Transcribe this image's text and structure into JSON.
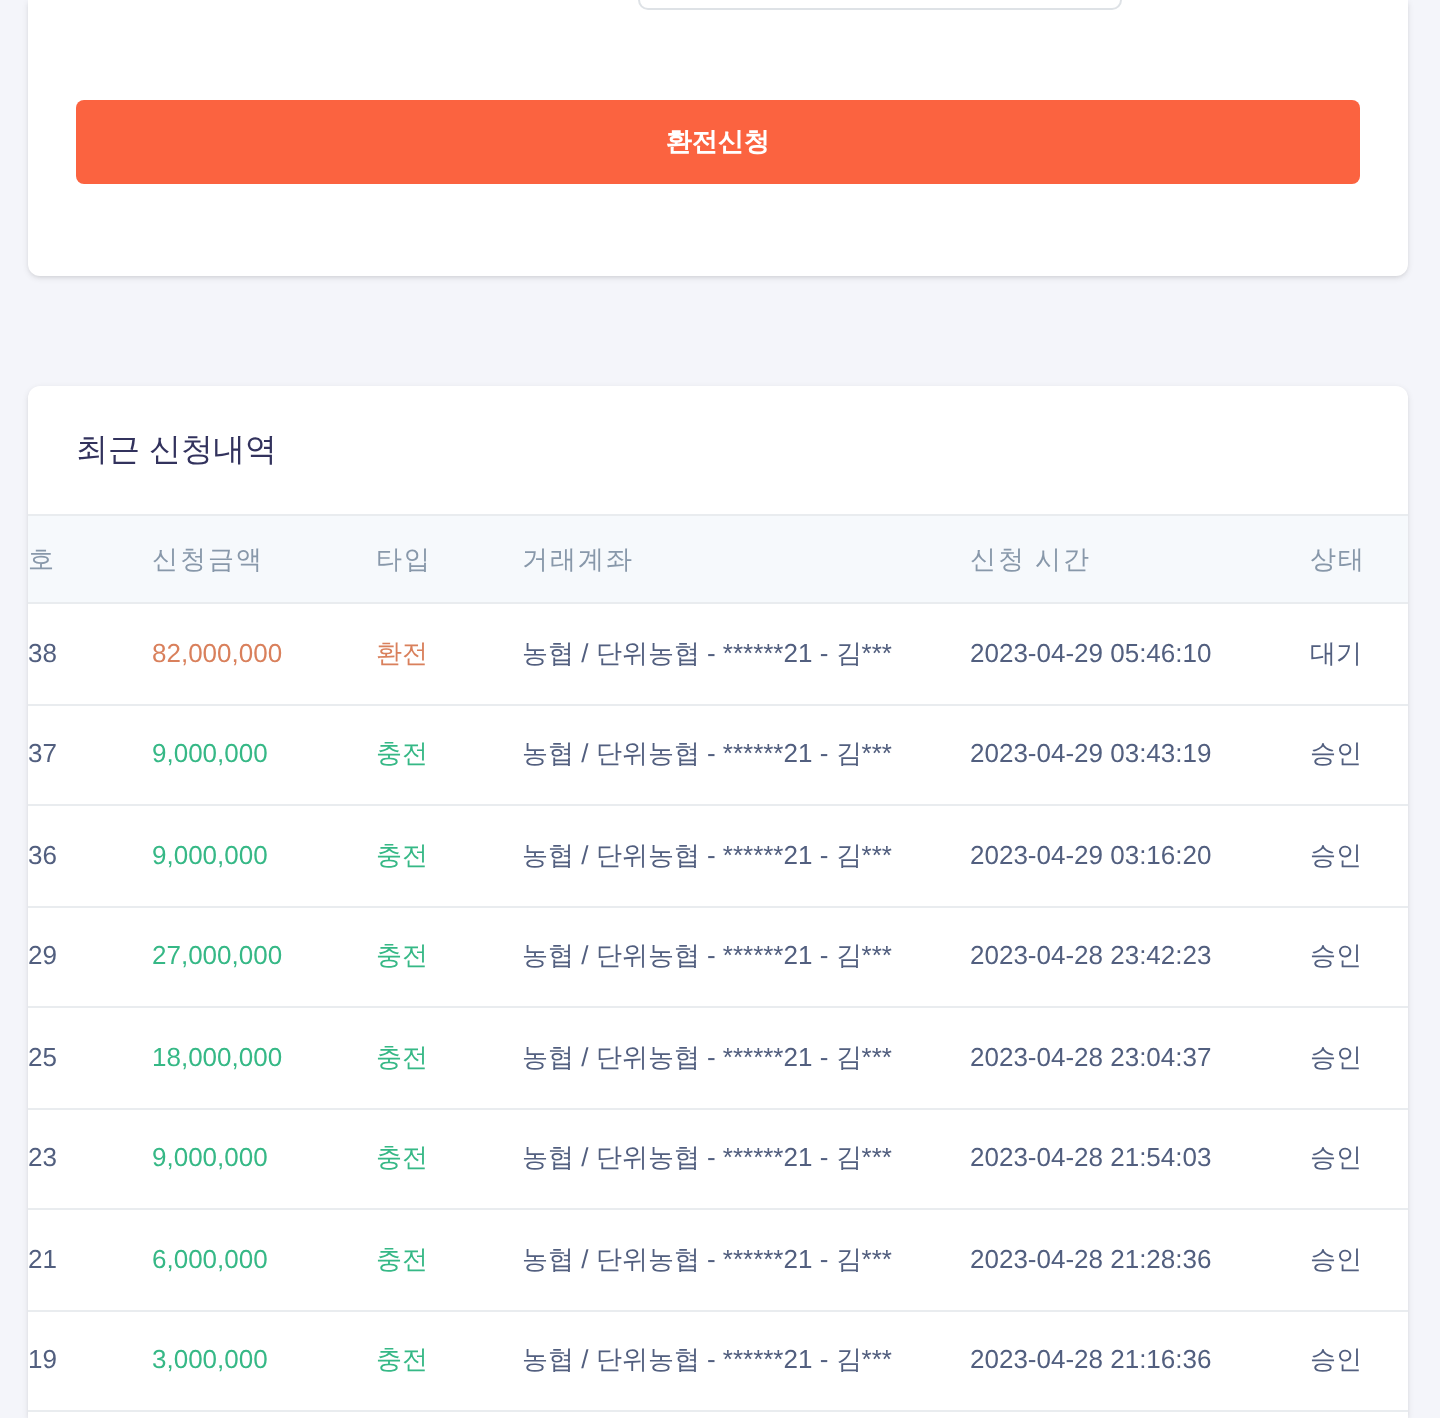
{
  "exchange_form": {
    "submit_button": "환전신청"
  },
  "history": {
    "title": "최근 신청내역",
    "columns": [
      "호",
      "신청금액",
      "타입",
      "거래계좌",
      "신청 시간",
      "상태"
    ],
    "rows": [
      {
        "kind": "exchange",
        "id": "38",
        "amount": "82,000,000",
        "type": "환전",
        "account": "농협 / 단위농협 - ******21 - 김***",
        "time": "2023-04-29 05:46:10",
        "status": "대기"
      },
      {
        "kind": "charge",
        "id": "37",
        "amount": "9,000,000",
        "type": "충전",
        "account": "농협 / 단위농협 - ******21 - 김***",
        "time": "2023-04-29 03:43:19",
        "status": "승인"
      },
      {
        "kind": "charge",
        "id": "36",
        "amount": "9,000,000",
        "type": "충전",
        "account": "농협 / 단위농협 - ******21 - 김***",
        "time": "2023-04-29 03:16:20",
        "status": "승인"
      },
      {
        "kind": "charge",
        "id": "29",
        "amount": "27,000,000",
        "type": "충전",
        "account": "농협 / 단위농협 - ******21 - 김***",
        "time": "2023-04-28 23:42:23",
        "status": "승인"
      },
      {
        "kind": "charge",
        "id": "25",
        "amount": "18,000,000",
        "type": "충전",
        "account": "농협 / 단위농협 - ******21 - 김***",
        "time": "2023-04-28 23:04:37",
        "status": "승인"
      },
      {
        "kind": "charge",
        "id": "23",
        "amount": "9,000,000",
        "type": "충전",
        "account": "농협 / 단위농협 - ******21 - 김***",
        "time": "2023-04-28 21:54:03",
        "status": "승인"
      },
      {
        "kind": "charge",
        "id": "21",
        "amount": "6,000,000",
        "type": "충전",
        "account": "농협 / 단위농협 - ******21 - 김***",
        "time": "2023-04-28 21:28:36",
        "status": "승인"
      },
      {
        "kind": "charge",
        "id": "19",
        "amount": "3,000,000",
        "type": "충전",
        "account": "농협 / 단위농협 - ******21 - 김***",
        "time": "2023-04-28 21:16:36",
        "status": "승인"
      }
    ]
  }
}
